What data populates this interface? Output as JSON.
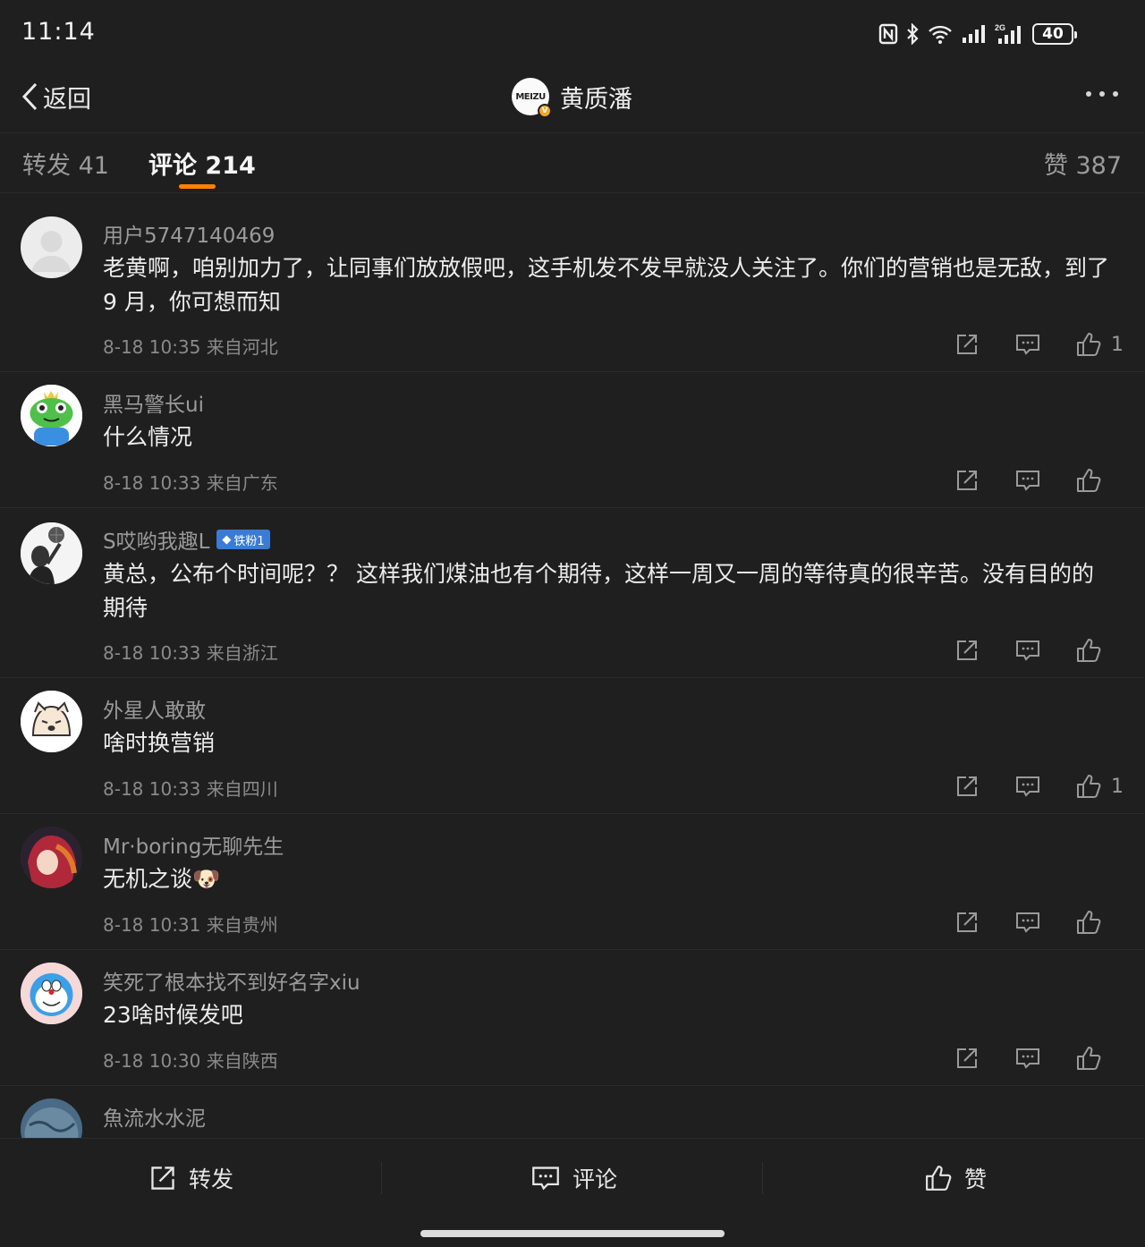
{
  "status": {
    "time": "11:14",
    "battery": "40",
    "network": "2G"
  },
  "nav": {
    "back_label": "返回",
    "avatar_text": "MEIZU",
    "verified": "V",
    "title": "黄质潘"
  },
  "tabs": [
    {
      "label": "转发 41"
    },
    {
      "label": "评论 214"
    },
    {
      "label": "赞 387"
    }
  ],
  "comments": [
    {
      "name": "用户5747140469",
      "text": "老黄啊，咱别加力了，让同事们放放假吧，这手机发不发早就没人关注了。你们的营销也是无敌，到了 9 月，你可想而知",
      "meta": "8-18 10:35 来自河北",
      "likes": "1"
    },
    {
      "name": "黑马警长ui",
      "text": "什么情况",
      "meta": "8-18 10:33 来自广东",
      "likes": ""
    },
    {
      "name": "S哎哟我趣L",
      "badge": "铁粉1",
      "text": "黄总，公布个时间呢？？ 这样我们煤油也有个期待，这样一周又一周的等待真的很辛苦。没有目的的期待",
      "meta": "8-18 10:33 来自浙江",
      "likes": ""
    },
    {
      "name": "外星人敢敢",
      "text": "啥时换营销",
      "meta": "8-18 10:33 来自四川",
      "likes": "1"
    },
    {
      "name": "Mr·boring无聊先生",
      "text": "无机之谈🐶",
      "meta": "8-18 10:31 来自贵州",
      "likes": ""
    },
    {
      "name": "笑死了根本找不到好名字xiu",
      "text": "23啥时候发吧",
      "meta": "8-18 10:30 来自陕西",
      "likes": ""
    },
    {
      "name": "魚流水水泥"
    }
  ],
  "bottom": {
    "repost": "转发",
    "comment": "评论",
    "like": "赞"
  },
  "colors": {
    "accent": "#ff8200",
    "background": "#1f1f1f",
    "fan_badge": "#3a7bd5",
    "verified": "#f5a623"
  }
}
